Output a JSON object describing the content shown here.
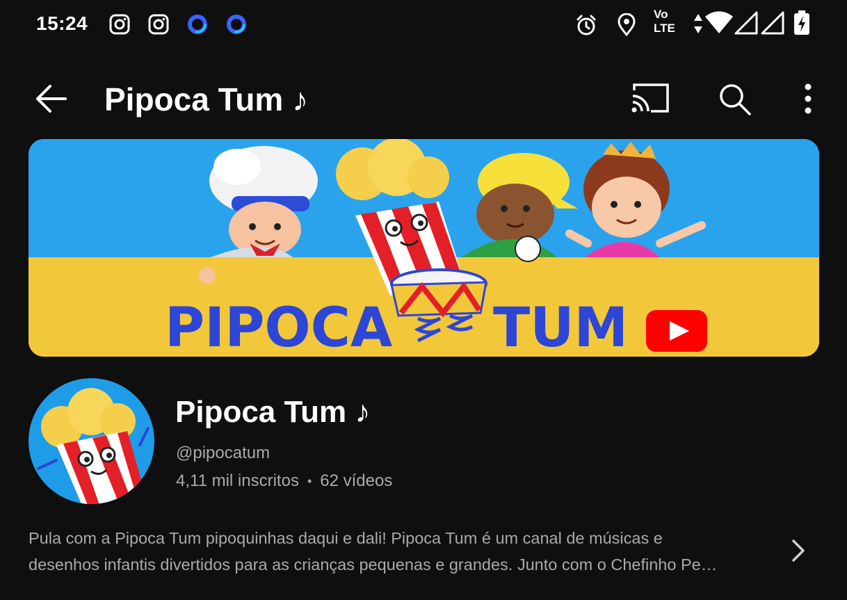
{
  "status_bar": {
    "time": "15:24",
    "notification_icons": [
      "instagram-icon",
      "instagram-icon",
      "circle-app-icon",
      "circle-app-icon"
    ],
    "system_icons": [
      "alarm-icon",
      "location-icon",
      "volte-icon",
      "data-arrows-icon",
      "wifi-icon",
      "cell-signal-icon",
      "cell-signal-icon",
      "battery-charging-icon"
    ],
    "volte_label_top": "Vo",
    "volte_label_bottom": "LTE"
  },
  "app_bar": {
    "title": "Pipoca Tum ♪",
    "actions": [
      "cast-icon",
      "search-icon",
      "more-vertical-icon"
    ]
  },
  "banner": {
    "logo_left": "PIPOCA",
    "logo_right": "TUM",
    "colors": {
      "sky": "#2aa3ec",
      "ground": "#f2c83a",
      "logo": "#2d46d6",
      "youtube_red": "#ff0000"
    }
  },
  "channel": {
    "name": "Pipoca Tum ♪",
    "handle": "@pipocatum",
    "subscribers": "4,11 mil inscritos",
    "separator": "•",
    "videos": "62 vídeos",
    "description_line1": "Pula com a Pipoca Tum pipoquinhas daqui e dali! Pipoca Tum é um canal de músicas e",
    "description_line2": "desenhos infantis divertidos para as crianças pequenas e grandes. Junto com o Chefinho Pe…"
  }
}
